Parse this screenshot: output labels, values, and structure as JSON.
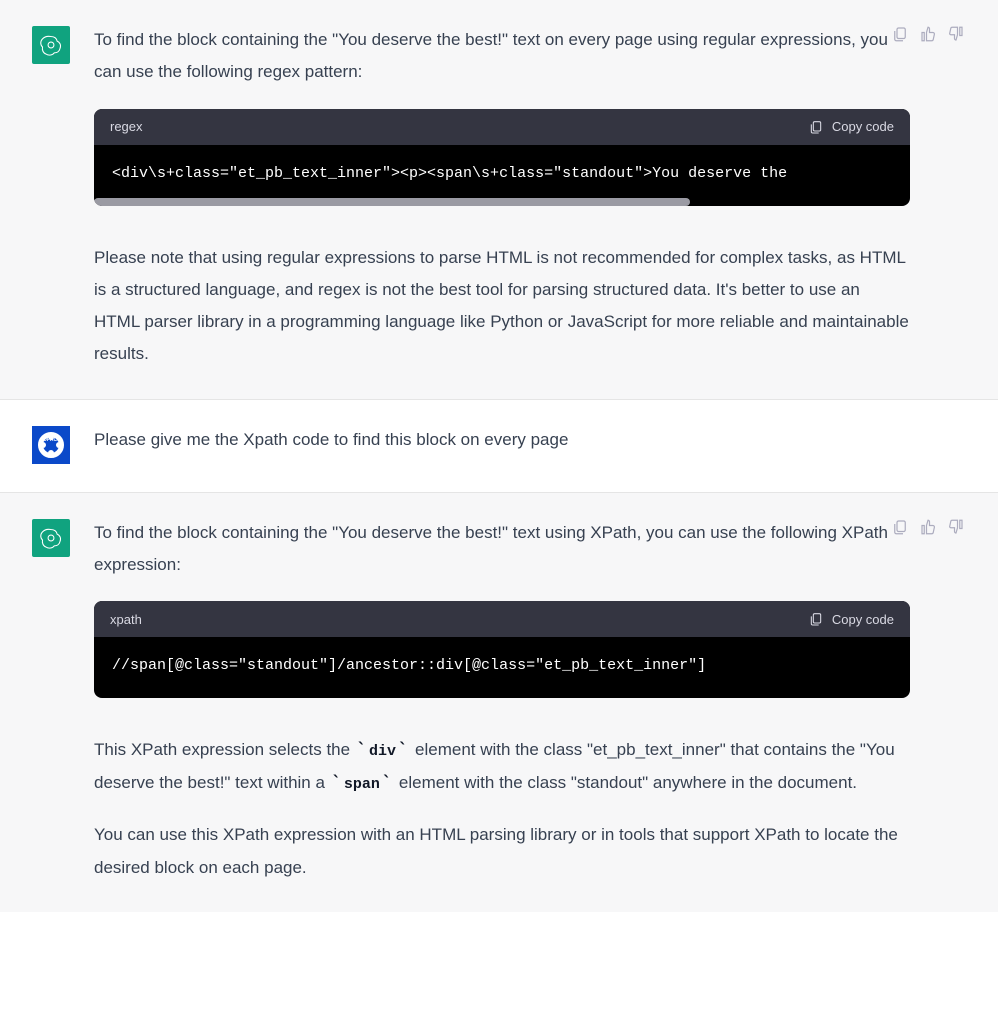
{
  "messages": [
    {
      "role": "assistant",
      "intro": "To find the block containing the \"You deserve the best!\" text on every page using regular expressions, you can use the following regex pattern:",
      "code": {
        "lang": "regex",
        "copy_label": "Copy code",
        "content": "<div\\s+class=\"et_pb_text_inner\"><p><span\\s+class=\"standout\">You deserve the"
      },
      "note": "Please note that using regular expressions to parse HTML is not recommended for complex tasks, as HTML is a structured language, and regex is not the best tool for parsing structured data. It's better to use an HTML parser library in a programming language like Python or JavaScript for more reliable and maintainable results."
    },
    {
      "role": "user",
      "text": "Please give me the Xpath code to find this block on every page"
    },
    {
      "role": "assistant",
      "intro": "To find the block containing the \"You deserve the best!\" text using XPath, you can use the following XPath expression:",
      "code": {
        "lang": "xpath",
        "copy_label": "Copy code",
        "content": "//span[@class=\"standout\"]/ancestor::div[@class=\"et_pb_text_inner\"]"
      },
      "explain_prefix": "This XPath expression selects the ",
      "inline1": "div",
      "explain_mid1": " element with the class \"et_pb_text_inner\" that contains the \"You deserve the best!\" text within a ",
      "inline2": "span",
      "explain_suffix": " element with the class \"standout\" anywhere in the document.",
      "footer": "You can use this XPath expression with an HTML parsing library or in tools that support XPath to locate the desired block on each page."
    }
  ],
  "action_labels": {
    "copy": "copy-message",
    "thumbs_up": "thumbs-up",
    "thumbs_down": "thumbs-down"
  }
}
